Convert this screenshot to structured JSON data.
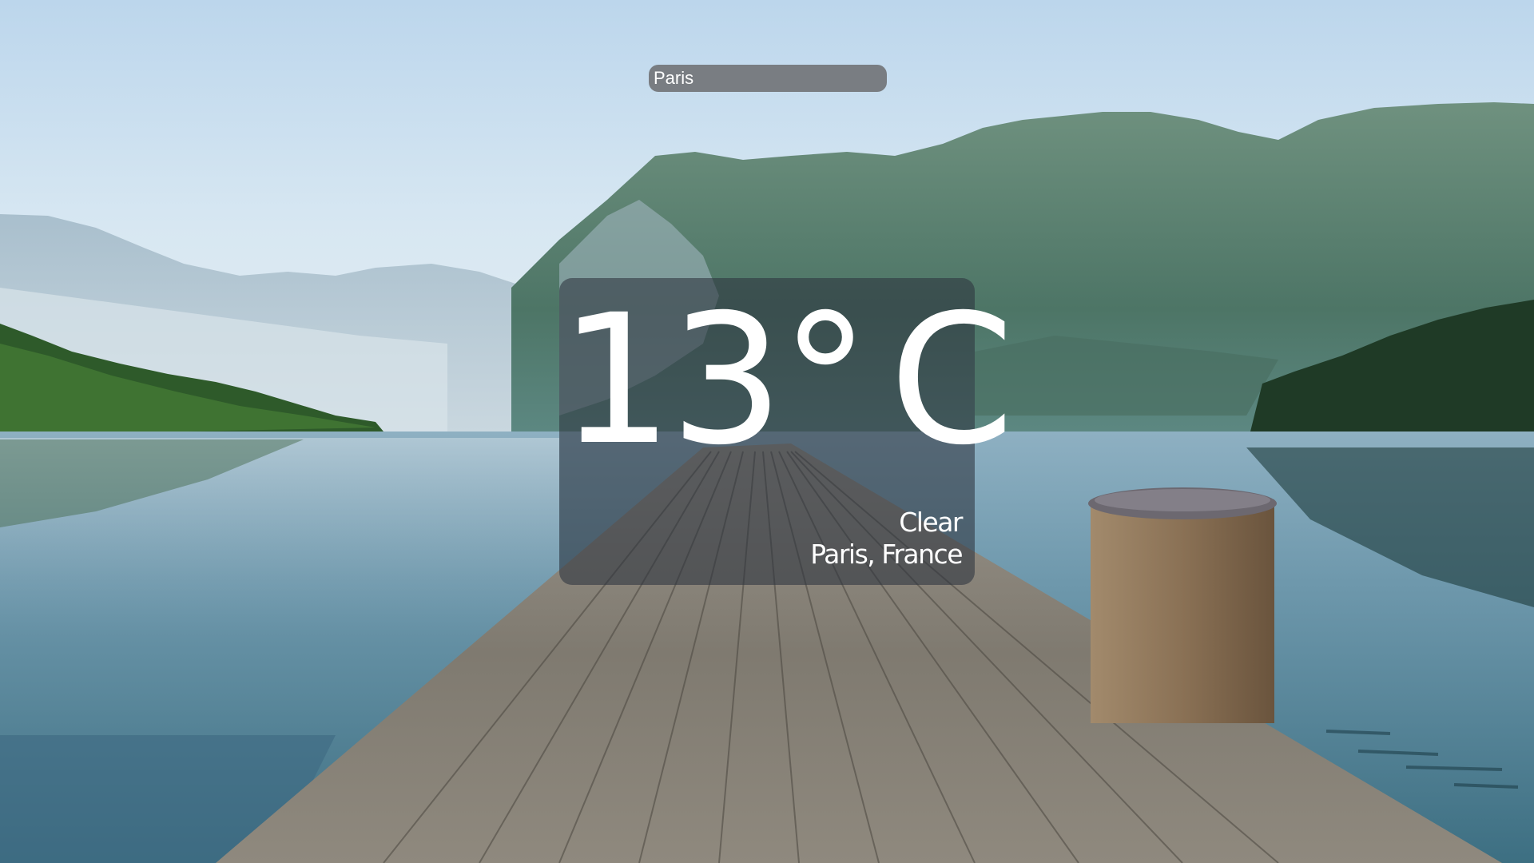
{
  "search": {
    "value": "Paris",
    "placeholder": "Paris"
  },
  "weather": {
    "temperature": "13°",
    "unit": "C",
    "condition": "Clear",
    "location": "Paris, France"
  },
  "background": {
    "description_icon": "landscape-photo",
    "sky_color": "#cfe3f2",
    "water_color": "#6f9bb0",
    "mountain_color": "#4f7a6a",
    "dock_color": "#8a8378"
  },
  "colors": {
    "card_bg": "#2d343e",
    "text": "#ffffff",
    "search_bg": "#6e7073"
  }
}
